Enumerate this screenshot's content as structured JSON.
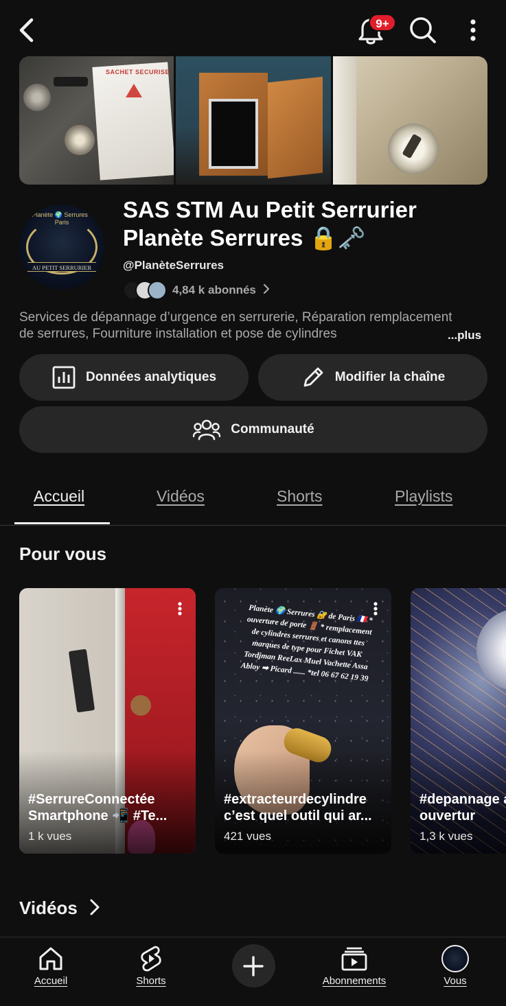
{
  "topbar": {
    "notifications_badge": "9+"
  },
  "channel": {
    "name": "SAS STM Au Petit Serrurier Planète Serrures 🔒🗝️",
    "handle": "@PlanèteSerrures",
    "subscribers": "4,84 k abonnés",
    "description": "Services de dépannage d’urgence en serrurerie, Réparation remplacement de serrures, Fourniture installation et pose de cylindres",
    "more_label": "...plus",
    "avatar_text_top": "Planète 🌍 Serrures · Paris",
    "avatar_text_ribbon": "AU PETIT SERRURIER",
    "banner_bag_text": "SACHET SECURISE"
  },
  "actions": {
    "analytics_label": "Données analytiques",
    "edit_label": "Modifier la chaîne",
    "community_label": "Communauté"
  },
  "tabs": [
    {
      "label": "Accueil",
      "active": true
    },
    {
      "label": "Vidéos",
      "active": false
    },
    {
      "label": "Shorts",
      "active": false
    },
    {
      "label": "Playlists",
      "active": false
    }
  ],
  "sections": {
    "for_you": "Pour vous",
    "videos": "Vidéos"
  },
  "shorts": [
    {
      "title": "#SerrureConnectée Smartphone 📲 #Te...",
      "views": "1 k vues"
    },
    {
      "title": "#extracteurdecylindre c’est quel outil qui ar...",
      "views": "421 vues",
      "overlay_text": "Planète 🌍 Serrures 🔐 de Paris 🇫🇷 * ouverture de porte 🚪 * remplacement de cylindres serrures et canons ttes marques de type pour Fichet VAK Tordjman ReeLax Muel Vachette Assa Abloy ➡ Picard ...... *tel 06 67 62 19 39"
    },
    {
      "title": "#depannage aris ouvertur",
      "views": "1,3 k vues"
    }
  ],
  "bottom_nav": [
    {
      "label": "Accueil",
      "icon": "home-icon"
    },
    {
      "label": "Shorts",
      "icon": "shorts-icon"
    },
    {
      "label": "",
      "icon": "create-plus-icon"
    },
    {
      "label": "Abonnements",
      "icon": "subscriptions-icon"
    },
    {
      "label": "Vous",
      "icon": "you-avatar"
    }
  ],
  "colors": {
    "background": "#0f0f0f",
    "pill": "#272727",
    "badge": "#e01e2b",
    "muted_text": "#aaaaaa"
  }
}
